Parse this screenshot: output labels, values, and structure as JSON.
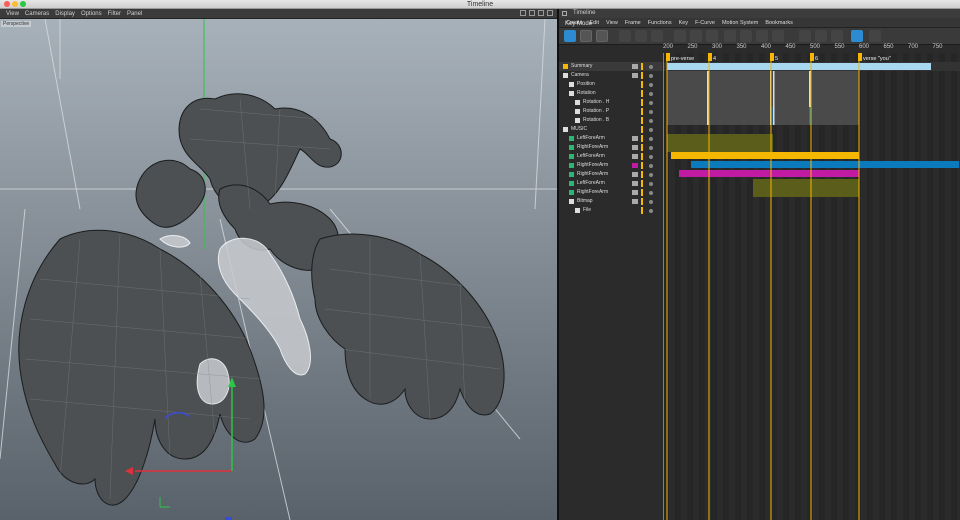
{
  "window": {
    "title": "Timeline"
  },
  "viewport": {
    "menu": [
      "View",
      "Cameras",
      "Display",
      "Options",
      "Filter",
      "Panel"
    ],
    "label": "Perspective"
  },
  "timeline": {
    "title": "Timeline",
    "menu": [
      "Create",
      "Edit",
      "View",
      "Frame",
      "Functions",
      "Key",
      "F-Curve",
      "Motion System",
      "Bookmarks"
    ],
    "key_mode": "Key Mode",
    "ruler": [
      "200",
      "250",
      "300",
      "350",
      "400",
      "450",
      "500",
      "550",
      "600",
      "650",
      "700",
      "750"
    ],
    "markers": [
      "pre-verse",
      "4",
      "5",
      "6",
      "verse \"you\""
    ],
    "tracks": [
      {
        "label": "Summary",
        "depth": 0
      },
      {
        "label": "Camera",
        "depth": 0
      },
      {
        "label": "Position",
        "depth": 1
      },
      {
        "label": "Rotation",
        "depth": 1
      },
      {
        "label": "Rotation . H",
        "depth": 2
      },
      {
        "label": "Rotation . P",
        "depth": 2
      },
      {
        "label": "Rotation . B",
        "depth": 2
      },
      {
        "label": "MUSIC",
        "depth": 0
      },
      {
        "label": "LeftForeArm",
        "depth": 1
      },
      {
        "label": "RightForeArm",
        "depth": 1
      },
      {
        "label": "LeftForeArm",
        "depth": 1
      },
      {
        "label": "RightForeArm",
        "depth": 1
      },
      {
        "label": "RightForeArm",
        "depth": 1
      },
      {
        "label": "LeftForeArm",
        "depth": 1
      },
      {
        "label": "RightForeArm",
        "depth": 1
      },
      {
        "label": "Bitmap",
        "depth": 1
      },
      {
        "label": "File",
        "depth": 2
      }
    ],
    "colors": {
      "accent": "#2d8cd1",
      "yellow": "#f5b700",
      "blue": "#0c7bbd",
      "magenta": "#c11aa3",
      "olive": "#5b5e1a",
      "summary": "#a8d8f0"
    }
  }
}
